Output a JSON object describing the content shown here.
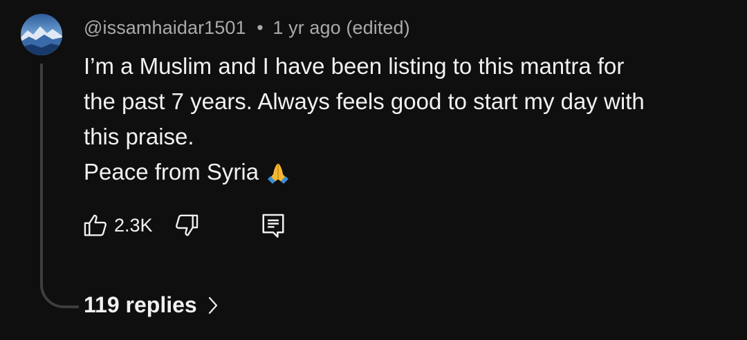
{
  "comment": {
    "author": "@issamhaidar1501",
    "separator": "•",
    "timestamp": "1 yr ago",
    "edited_label": "(edited)",
    "text_lines": [
      "I’m a Muslim and I have been listing to this mantra for",
      "the past 7 years. Always feels good to start my day with",
      "this praise.",
      "Peace from Syria"
    ],
    "emoji": "folded-hands-emoji"
  },
  "actions": {
    "like_icon": "thumbs-up-icon",
    "like_count": "2.3K",
    "dislike_icon": "thumbs-down-icon",
    "reply_icon": "reply-icon"
  },
  "replies": {
    "label": "119 replies",
    "icon": "chevron-right-icon"
  },
  "colors": {
    "background": "#0f0f0f",
    "primary_text": "#f1f1f1",
    "secondary_text": "#aaaaaa",
    "thread_line": "#3d3d3d"
  }
}
